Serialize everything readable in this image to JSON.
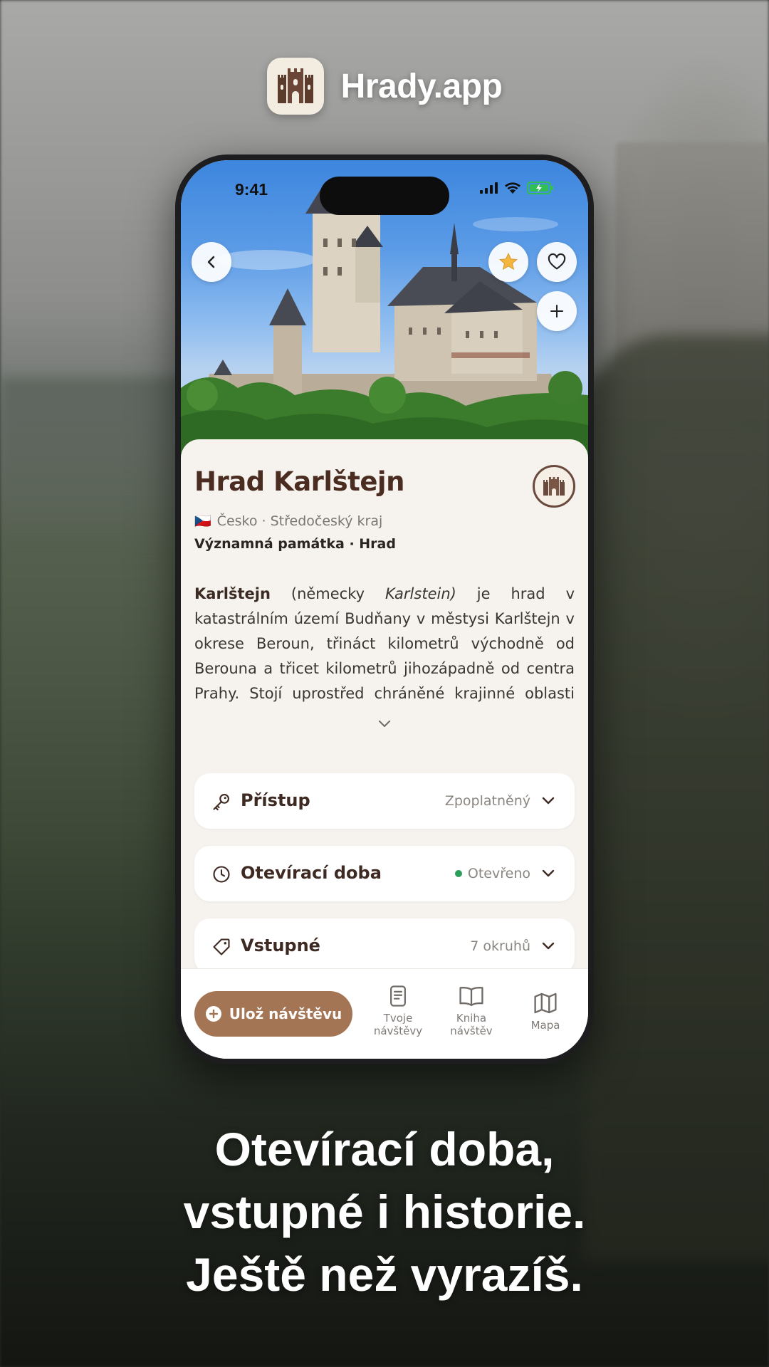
{
  "app": {
    "name": "Hrady.app"
  },
  "status_bar": {
    "time": "9:41"
  },
  "castle": {
    "title": "Hrad Karlštejn",
    "flag": "🇨🇿",
    "location": "Česko · Středočeský kraj",
    "category": "Významná památka · Hrad",
    "description": {
      "name_bold": "Karlštejn",
      "pre_italic": " (německy ",
      "italic": "Karlstein)",
      "rest": " je hrad v katastrálním území Budňany v městysi Karlštejn v okrese Beroun, třináct kilometrů východně od Berouna a třicet kilometrů jihozápadně od centra Prahy. Stojí uprostřed chráněné krajinné oblasti Český kras"
    }
  },
  "cards": [
    {
      "label": "Přístup",
      "value": "Zpoplatněný",
      "icon": "key-icon"
    },
    {
      "label": "Otevírací doba",
      "value": "Otevřeno",
      "icon": "clock-icon",
      "status_color": "#2e9e5b"
    },
    {
      "label": "Vstupné",
      "value": "7 okruhů",
      "icon": "tag-icon"
    }
  ],
  "bottom_nav": {
    "save_label": "Ulož návštěvu",
    "items": [
      {
        "label": "Tvoje návštěvy",
        "icon": "document-icon"
      },
      {
        "label": "Kniha návštěv",
        "icon": "book-icon"
      },
      {
        "label": "Mapa",
        "icon": "map-icon"
      }
    ]
  },
  "caption": {
    "line1": "Otevírací doba,",
    "line2": "vstupné i historie.",
    "line3": "Ještě než vyrazíš."
  },
  "colors": {
    "accent": "#a47555",
    "title": "#4a2c20",
    "open": "#2e9e5b"
  }
}
